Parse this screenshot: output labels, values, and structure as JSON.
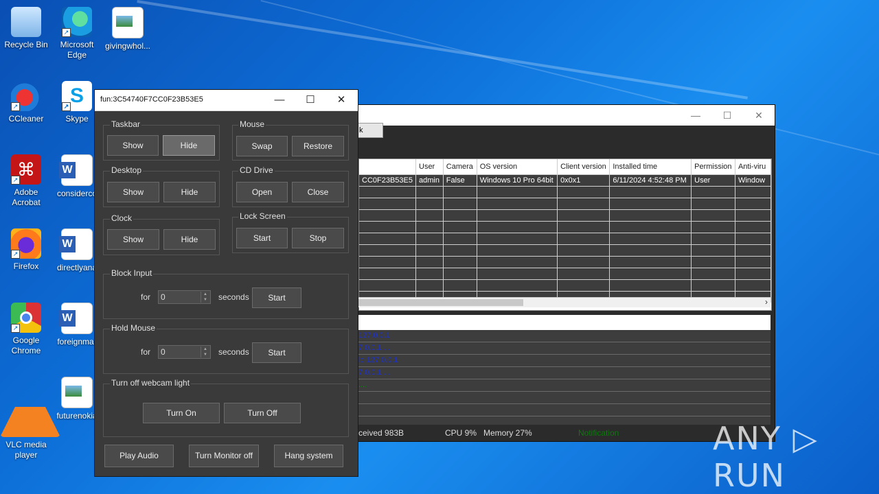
{
  "desktop_icons": [
    {
      "id": "recycle-bin",
      "label": "Recycle Bin",
      "icon": "recycle-bin-icon",
      "shortcut": false
    },
    {
      "id": "edge",
      "label": "Microsoft Edge",
      "icon": "edge-icon",
      "shortcut": true
    },
    {
      "id": "givingwhol",
      "label": "givingwhol...",
      "icon": "image-file-icon",
      "shortcut": false
    },
    {
      "id": "ccleaner",
      "label": "CCleaner",
      "icon": "ccleaner-icon",
      "shortcut": true
    },
    {
      "id": "skype",
      "label": "Skype",
      "icon": "skype-icon",
      "shortcut": true,
      "glyph": "S"
    },
    {
      "id": "acrobat",
      "label": "Adobe Acrobat",
      "icon": "acrobat-icon",
      "shortcut": true,
      "glyph": "⌘"
    },
    {
      "id": "considerco",
      "label": "considerco",
      "icon": "word-doc-icon",
      "shortcut": false
    },
    {
      "id": "firefox",
      "label": "Firefox",
      "icon": "firefox-icon",
      "shortcut": true
    },
    {
      "id": "directlyana",
      "label": "directlyana",
      "icon": "word-doc-icon",
      "shortcut": false
    },
    {
      "id": "chrome",
      "label": "Google Chrome",
      "icon": "chrome-icon",
      "shortcut": true
    },
    {
      "id": "foreignmar",
      "label": "foreignmar",
      "icon": "word-doc-icon",
      "shortcut": false
    },
    {
      "id": "vlc",
      "label": "VLC media player",
      "icon": "vlc-icon",
      "shortcut": true
    },
    {
      "id": "futurenokia",
      "label": "futurenokia",
      "icon": "image-file-icon",
      "shortcut": false
    }
  ],
  "bg_window": {
    "tab_label": "k",
    "columns": [
      "User",
      "Camera",
      "OS version",
      "Client version",
      "Installed time",
      "Permission",
      "Anti-viru"
    ],
    "first_col_value": "CC0F23B53E5",
    "row": [
      "admin",
      "False",
      "Windows 10 Pro 64bit",
      "0x0x1",
      "6/11/2024 4:52:48 PM",
      "User",
      "Window"
    ],
    "log_lines": [
      "127.0.0.1",
      "7.0.0.1 ...",
      "lo 127.0.0.1",
      "7.0.0.1 ...",
      "...."
    ],
    "status": {
      "received": "ceived  983B",
      "cpu": "CPU 9%",
      "memory": "Memory 27%",
      "notification": "Notification"
    },
    "scroll_arrow": "›"
  },
  "dialog": {
    "title": "fun:3C54740F7CC0F23B53E5",
    "controls": {
      "minimize": "—",
      "maximize": "☐",
      "close": "✕"
    },
    "taskbar": {
      "label": "Taskbar",
      "show": "Show",
      "hide": "Hide"
    },
    "mouse": {
      "label": "Mouse",
      "swap": "Swap",
      "restore": "Restore"
    },
    "desktop": {
      "label": "Desktop",
      "show": "Show",
      "hide": "Hide"
    },
    "cd_drive": {
      "label": "CD Drive",
      "open": "Open",
      "close": "Close"
    },
    "clock": {
      "label": "Clock",
      "show": "Show",
      "hide": "Hide"
    },
    "lock_screen": {
      "label": "Lock Screen",
      "start": "Start",
      "stop": "Stop"
    },
    "block_input": {
      "label": "Block Input",
      "for": "for",
      "value": "0",
      "seconds": "seconds",
      "start": "Start"
    },
    "hold_mouse": {
      "label": "Hold Mouse",
      "for": "for",
      "value": "0",
      "seconds": "seconds",
      "start": "Start"
    },
    "webcam": {
      "label": "Turn off webcam light",
      "on": "Turn On",
      "off": "Turn Off"
    },
    "bottom": {
      "play_audio": "Play Audio",
      "turn_monitor_off": "Turn Monitor off",
      "hang_system": "Hang system"
    }
  },
  "watermark": "ANY ▷ RUN"
}
